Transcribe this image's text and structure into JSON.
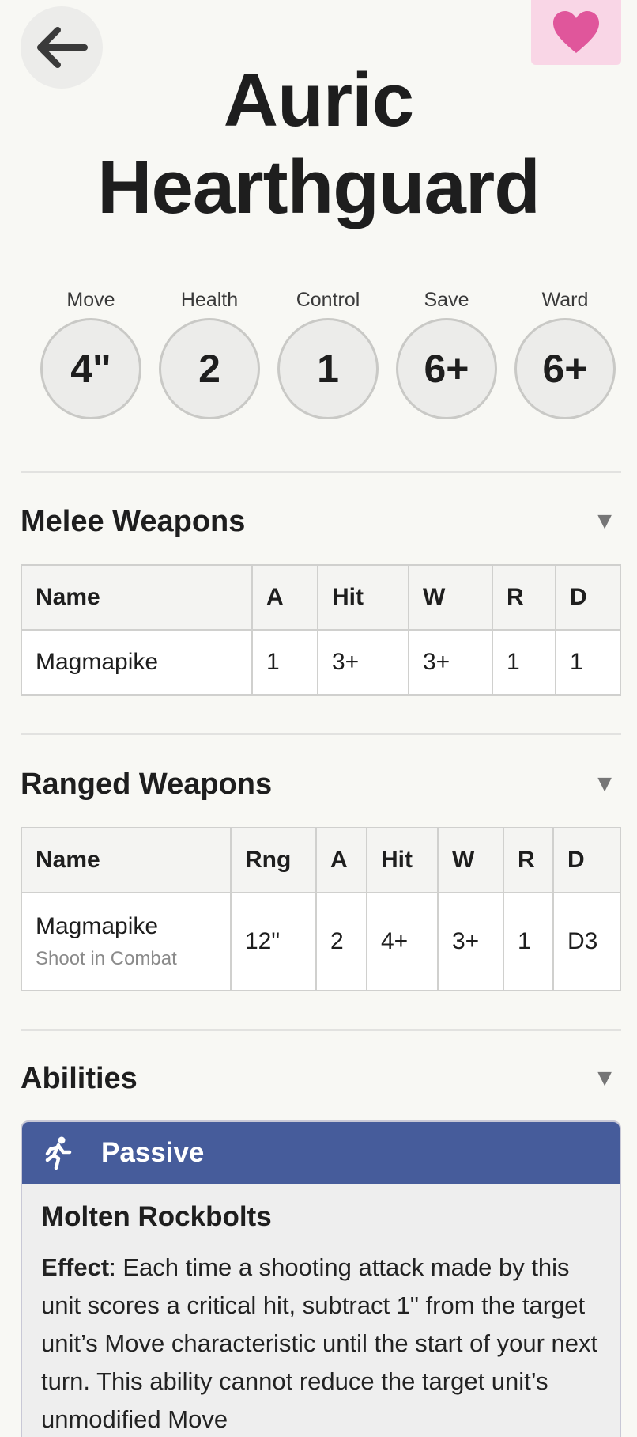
{
  "unit": {
    "title_line1": "Auric",
    "title_line2": "Hearthguard"
  },
  "stats": [
    {
      "label": "Move",
      "value": "4\""
    },
    {
      "label": "Health",
      "value": "2"
    },
    {
      "label": "Control",
      "value": "1"
    },
    {
      "label": "Save",
      "value": "6+"
    },
    {
      "label": "Ward",
      "value": "6+"
    }
  ],
  "melee": {
    "title": "Melee Weapons",
    "headers": [
      "Name",
      "A",
      "Hit",
      "W",
      "R",
      "D"
    ],
    "rows": [
      {
        "name": "Magmapike",
        "a": "1",
        "hit": "3+",
        "w": "3+",
        "r": "1",
        "d": "1"
      }
    ]
  },
  "ranged": {
    "title": "Ranged Weapons",
    "headers": [
      "Name",
      "Rng",
      "A",
      "Hit",
      "W",
      "R",
      "D"
    ],
    "rows": [
      {
        "name": "Magmapike",
        "note": "Shoot in Combat",
        "rng": "12\"",
        "a": "2",
        "hit": "4+",
        "w": "3+",
        "r": "1",
        "d": "D3"
      }
    ]
  },
  "abilities": {
    "title": "Abilities",
    "items": [
      {
        "type": "Passive",
        "name": "Molten Rockbolts",
        "effect_label": "Effect",
        "effect_text": ": Each time a shooting attack made by this unit scores a critical hit, subtract 1\" from the target unit’s Move characteristic until the start of your next turn. This ability cannot reduce the target unit’s unmodified Move"
      }
    ]
  },
  "icons": {
    "back": "arrow-left-icon",
    "favorite": "heart-icon",
    "collapse": "caret-down-icon",
    "passive": "running-figure-icon"
  },
  "colors": {
    "favorite_bg": "#f9d6e6",
    "heart": "#e0569b",
    "passive_header": "#465c9b"
  }
}
